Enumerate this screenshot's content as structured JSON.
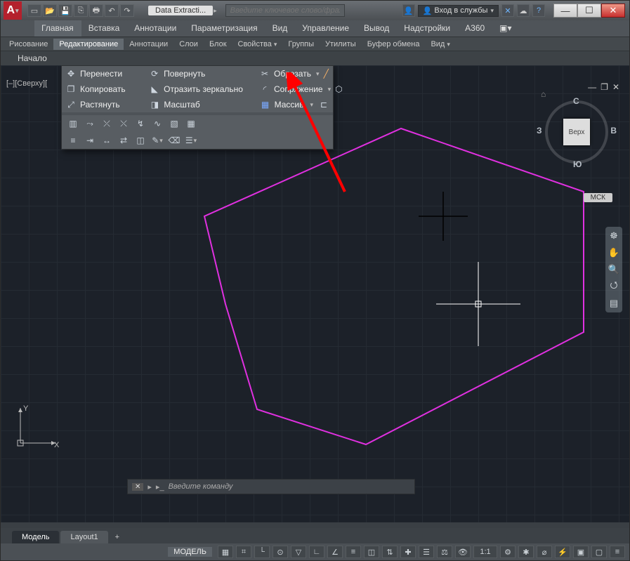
{
  "title_tab": "Data Extracti...",
  "search_placeholder": "Введите ключевое слово/фразу",
  "signin_label": "Вход в службы",
  "menubar": [
    "Главная",
    "Вставка",
    "Аннотации",
    "Параметризация",
    "Вид",
    "Управление",
    "Вывод",
    "Надстройки",
    "A360"
  ],
  "menubar_active": 0,
  "panels": [
    "Рисование",
    "Редактирование",
    "Аннотации",
    "Слои",
    "Блок",
    "Свойства",
    "Группы",
    "Утилиты",
    "Буфер обмена",
    "Вид"
  ],
  "panels_active": 1,
  "doc_start": "Начало",
  "view_label": "[–][Сверху][",
  "flyout": {
    "r1c1": "Перенести",
    "r1c2": "Повернуть",
    "r1c3": "Обрезать",
    "r2c1": "Копировать",
    "r2c2": "Отразить зеркально",
    "r2c3": "Сопряжение",
    "r3c1": "Растянуть",
    "r3c2": "Масштаб",
    "r3c3": "Массив"
  },
  "viewcube": {
    "face": "Верх",
    "n": "С",
    "s": "Ю",
    "e": "В",
    "w": "З"
  },
  "msk_label": "МСК",
  "tabs": {
    "model": "Модель",
    "layout": "Layout1"
  },
  "cmd_placeholder": "Введите команду",
  "status_model": "МОДЕЛЬ",
  "status_scale": "1:1",
  "ucs": {
    "x": "X",
    "y": "Y"
  }
}
